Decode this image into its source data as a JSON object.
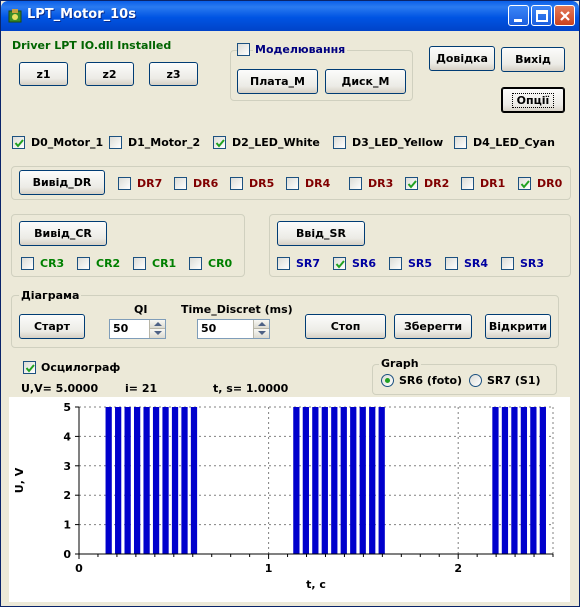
{
  "window": {
    "title": "LPT_Motor_10s"
  },
  "driver_status": "Driver LPT IO.dll Installed",
  "z_buttons": [
    {
      "label": "z1"
    },
    {
      "label": "z2"
    },
    {
      "label": "z3"
    }
  ],
  "modeling": {
    "label": "Моделювання",
    "checked": false,
    "board_button": "Плата_М",
    "disk_button": "Диск_М"
  },
  "right_buttons": {
    "help": "Довідка",
    "exit": "Вихід",
    "options": "Опції"
  },
  "data_outputs": [
    {
      "label": "D0_Motor_1",
      "checked": true
    },
    {
      "label": "D1_Motor_2",
      "checked": false
    },
    {
      "label": "D2_LED_White",
      "checked": true
    },
    {
      "label": "D3_LED_Yellow",
      "checked": false
    },
    {
      "label": "D4_LED_Cyan",
      "checked": false
    }
  ],
  "dr": {
    "button": "Вивід_DR",
    "bits": [
      {
        "label": "DR7",
        "checked": false
      },
      {
        "label": "DR6",
        "checked": false
      },
      {
        "label": "DR5",
        "checked": false
      },
      {
        "label": "DR4",
        "checked": false
      },
      {
        "label": "DR3",
        "checked": false
      },
      {
        "label": "DR2",
        "checked": true
      },
      {
        "label": "DR1",
        "checked": false
      },
      {
        "label": "DR0",
        "checked": true
      }
    ]
  },
  "cr": {
    "button": "Вивід_CR",
    "bits": [
      {
        "label": "CR3",
        "checked": false
      },
      {
        "label": "CR2",
        "checked": false
      },
      {
        "label": "CR1",
        "checked": false
      },
      {
        "label": "CR0",
        "checked": false
      }
    ]
  },
  "sr": {
    "button": "Ввід_SR",
    "bits": [
      {
        "label": "SR7",
        "checked": false
      },
      {
        "label": "SR6",
        "checked": true
      },
      {
        "label": "SR5",
        "checked": false
      },
      {
        "label": "SR4",
        "checked": false
      },
      {
        "label": "SR3",
        "checked": false
      }
    ]
  },
  "diagram": {
    "legend": "Діаграма",
    "start": "Старт",
    "qi_label": "QI",
    "qi_value": "50",
    "time_label": "Time_Discret (ms)",
    "time_value": "50",
    "stop": "Стоп",
    "save": "Зберегти",
    "open": "Відкрити"
  },
  "oscillograph": {
    "label": "Осцилограф",
    "checked": true
  },
  "readout": {
    "u": "U,V= 5.0000",
    "i": "i= 21",
    "t": "t, s= 1.0000"
  },
  "graph_group": {
    "legend": "Graph",
    "options": [
      {
        "label": "SR6 (foto)",
        "selected": true
      },
      {
        "label": "SR7 (S1)",
        "selected": false
      }
    ]
  },
  "colors": {
    "bar": "#0000cc",
    "grid": "#808080",
    "title_bar": "#0054e3",
    "dr_text": "#800000",
    "cr_text": "#008000",
    "sr_text": "#0000a0"
  },
  "chart_data": {
    "type": "bar",
    "xlabel": "t, c",
    "ylabel": "U, V",
    "xlim": [
      0,
      2.5
    ],
    "ylim": [
      0,
      5
    ],
    "x_ticks": [
      "0",
      "1",
      "2"
    ],
    "y_ticks": [
      "0",
      "1",
      "2",
      "3",
      "4",
      "5"
    ],
    "grid": true,
    "bar_value": 5,
    "pulse_groups": [
      {
        "start": 0.14,
        "count": 10,
        "period": 0.05
      },
      {
        "start": 1.13,
        "count": 10,
        "period": 0.05
      },
      {
        "start": 2.18,
        "count": 6,
        "period": 0.05
      }
    ]
  }
}
